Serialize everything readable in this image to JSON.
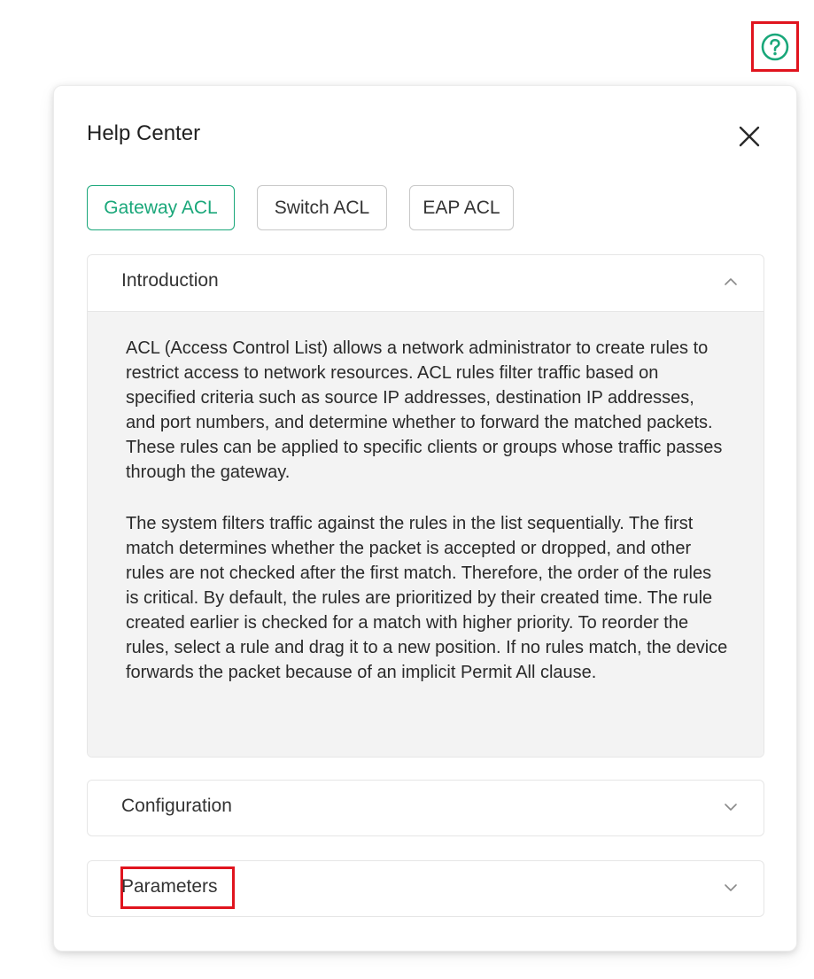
{
  "help_trigger": {
    "icon": "question-circle-icon",
    "color": "#1aa77a"
  },
  "panel": {
    "title": "Help Center",
    "close_icon": "close-icon"
  },
  "tabs": [
    {
      "label": "Gateway ACL",
      "active": true
    },
    {
      "label": "Switch ACL",
      "active": false
    },
    {
      "label": "EAP ACL",
      "active": false
    }
  ],
  "sections": {
    "introduction": {
      "label": "Introduction",
      "expanded": true,
      "paragraphs": [
        "ACL (Access Control List) allows a network administrator to create rules to restrict access to network resources. ACL rules filter traffic based on specified criteria such as source IP addresses, destination IP addresses, and port numbers, and determine whether to forward the matched packets. These rules can be applied to specific clients or groups whose traffic passes through the gateway.",
        "The system filters traffic against the rules in the list sequentially. The first match determines whether the packet is accepted or dropped, and other rules are not checked after the first match. Therefore, the order of the rules is critical. By default, the rules are prioritized by their created time. The rule created earlier is checked for a match with higher priority. To reorder the rules, select a rule and drag it to a new position. If no rules match, the device forwards the packet because of an implicit Permit All clause."
      ]
    },
    "configuration": {
      "label": "Configuration",
      "expanded": false
    },
    "parameters": {
      "label": "Parameters",
      "expanded": false
    }
  },
  "colors": {
    "accent": "#1aa77a",
    "highlight": "#e0141e",
    "body_bg": "#f3f3f3"
  }
}
